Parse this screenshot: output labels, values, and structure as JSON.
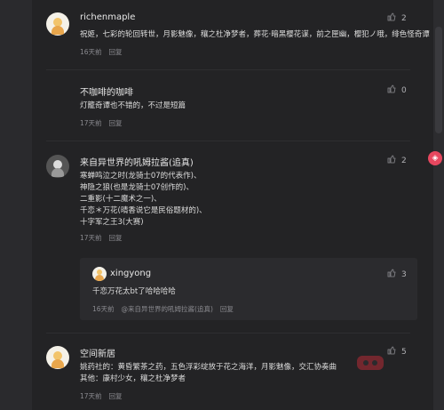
{
  "comments": [
    {
      "name": "richenmaple",
      "text": "祝姬，七彩的轮回转世，月影魅像，穰之杜净梦者，葬花·暗黑樱花谋，前之匣幽，樱犯ノ哦，绯色怪奇谭",
      "time": "16天前",
      "reply": "回复",
      "likes": "2"
    },
    {
      "name": "不咖啡的咖啡",
      "text": "灯籠奇谭也不错的，不过是短篇",
      "time": "17天前",
      "reply": "回复",
      "likes": "0"
    },
    {
      "name": "来自异世界的吼姆拉酱(追真)",
      "text_lines": [
        "寒蝉鸣泣之时(龙骑士07的代表作)、",
        "神隐之狼(也是龙骑士07创作的)、",
        "二重影(十二魔术之一)、",
        "千恋＊万花(晴香说它是民俗题材的)、",
        "十字军之王3(大赛)"
      ],
      "time": "17天前",
      "reply": "回复",
      "likes": "2"
    },
    {
      "name": "xingyong",
      "text": "千恋万花太bt了哈哈哈哈",
      "time": "16天前",
      "reply_to": "@来自异世界的吼姆拉酱(追真)",
      "reply": "回复",
      "likes": "3"
    },
    {
      "name": "空间新居",
      "text_lines": [
        "姚药社的：黄昏繁茶之药，五色浮彩绽放于花之海洋，月影魅像，交汇协奏曲",
        "其他：康村少女，穰之杜净梦者"
      ],
      "time": "17天前",
      "reply": "回复",
      "likes": "5"
    }
  ],
  "side": {
    "icon": "bilibili-icon"
  }
}
